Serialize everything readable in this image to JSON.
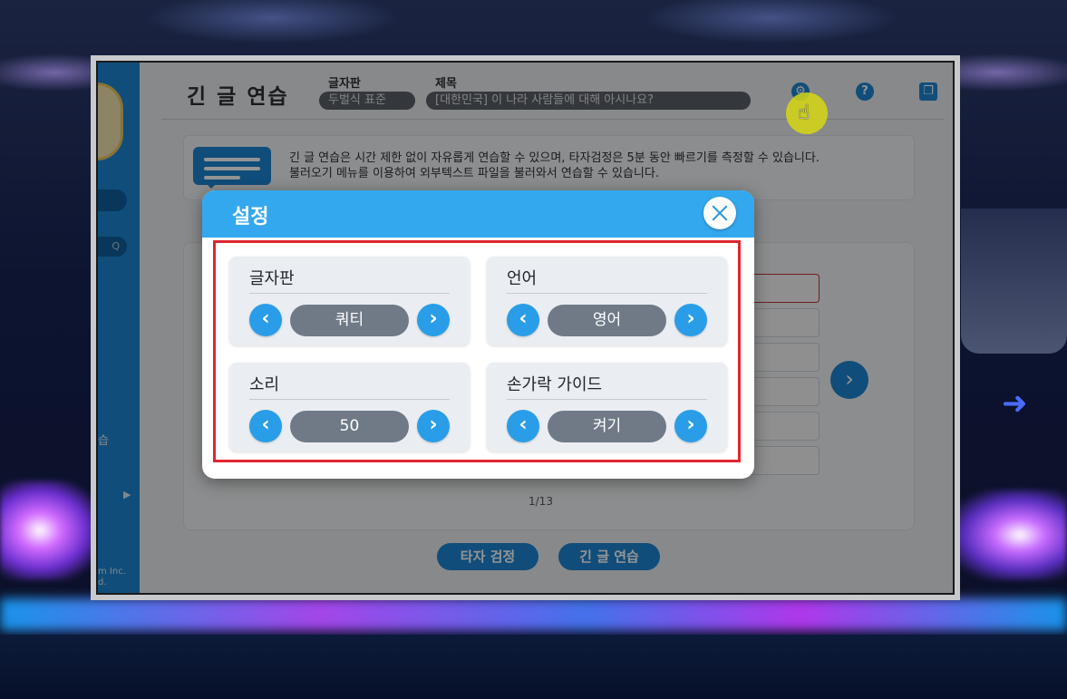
{
  "app": {
    "title": "긴 글 연습",
    "keyboard_label": "글자판",
    "keyboard_value": "두벌식 표준",
    "subject_label": "제목",
    "subject_value": "[대한민국] 이 나라 사람들에 대해 아시나요?",
    "help_icon": "?",
    "info_line1": "긴 글 연습은 시간 제한 없이 자유롭게 연습할 수 있으며, 타자검정은 5분 동안 빠르기를 측정할 수 있습니다.",
    "info_line2": "불러오기 메뉴를 이용하여 외부텍스트 파일을 불러와서 연습할 수 있습니다.",
    "page_indicator": "1/13",
    "next_arrow": "›",
    "bottom_buttons": [
      "타자 검정",
      "긴 글 연습"
    ]
  },
  "sidebar": {
    "pill_text": "Q",
    "menu_text": "습",
    "menu_arrow": "▶",
    "copyright_line1": "m Inc.",
    "copyright_line2": "d."
  },
  "dialog": {
    "title": "설정",
    "left_arrow": "‹",
    "right_arrow": "›",
    "settings": [
      {
        "label": "글자판",
        "value": "쿼티"
      },
      {
        "label": "언어",
        "value": "영어"
      },
      {
        "label": "소리",
        "value": "50"
      },
      {
        "label": "손가락 가이드",
        "value": "켜기"
      }
    ]
  },
  "colors": {
    "accent": "#2a9de8",
    "header": "#33a8ee",
    "highlight": "#e0262e",
    "cursor_halo": "#d7d714"
  }
}
